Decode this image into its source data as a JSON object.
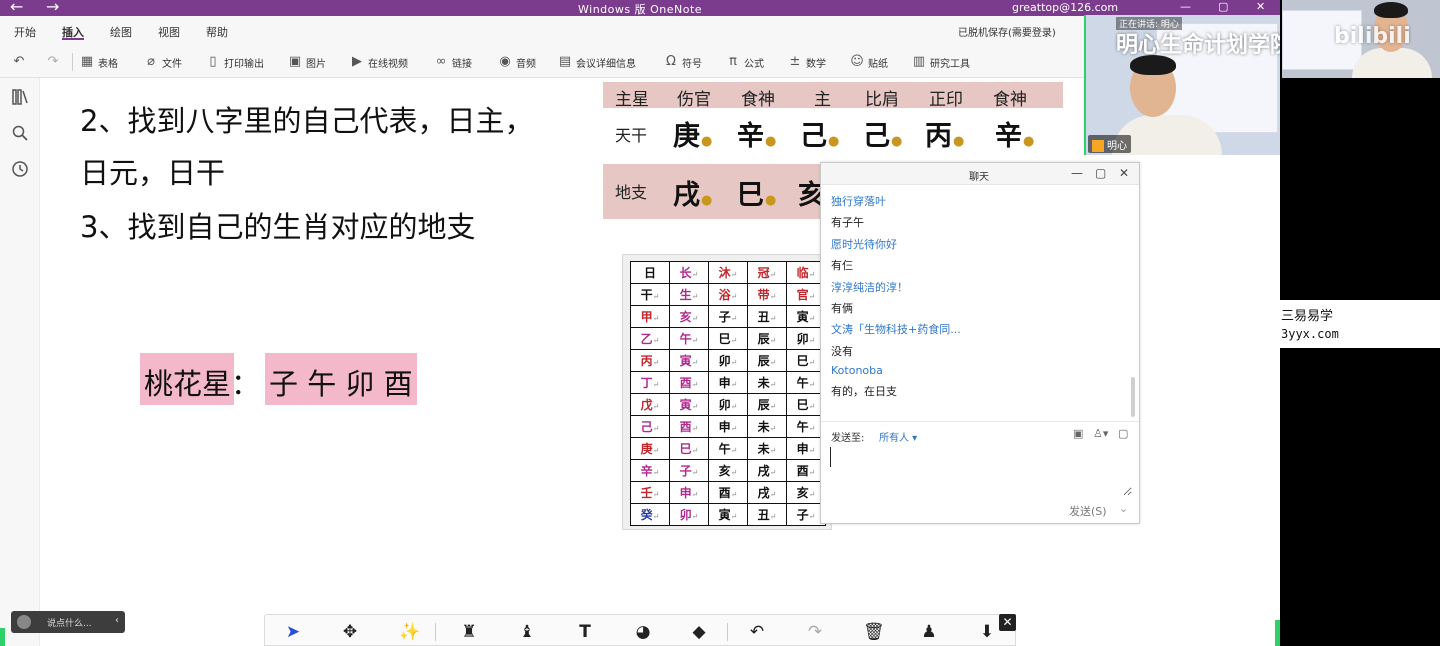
{
  "app": {
    "window_title": "Windows 版 OneNote",
    "user_email": "greattop@126.com",
    "save_status": "已脱机保存(需要登录)"
  },
  "menu_tabs": [
    "开始",
    "插入",
    "绘图",
    "视图",
    "帮助"
  ],
  "ribbon": {
    "items": [
      {
        "label": "表格",
        "icon": "table-icon"
      },
      {
        "label": "文件",
        "icon": "paperclip-icon"
      },
      {
        "label": "打印输出",
        "icon": "document-icon"
      },
      {
        "label": "图片",
        "icon": "image-icon"
      },
      {
        "label": "在线视频",
        "icon": "video-icon"
      },
      {
        "label": "链接",
        "icon": "link-icon"
      },
      {
        "label": "音频",
        "icon": "audio-icon"
      },
      {
        "label": "会议详细信息",
        "icon": "calendar-icon"
      },
      {
        "label": "符号",
        "icon": "omega-icon"
      },
      {
        "label": "公式",
        "icon": "pi-icon"
      },
      {
        "label": "数学",
        "icon": "math-icon"
      },
      {
        "label": "贴纸",
        "icon": "sticker-icon"
      },
      {
        "label": "研究工具",
        "icon": "research-icon"
      }
    ]
  },
  "note": {
    "line1": "2、找到八字里的自己代表，日主，",
    "line2": "日元，日干",
    "line3": "3、找到自己的生肖对应的地支",
    "peach_label": "桃花星：",
    "peach_list": "子 午 卯 酉"
  },
  "bazi": {
    "headers": [
      "主星",
      "伤官",
      "食神",
      "主",
      "比肩",
      "正印",
      "食神"
    ],
    "tiangan_label": "天干",
    "tiangan": [
      "庚",
      "辛",
      "己",
      "己",
      "丙",
      "辛"
    ],
    "dizhi_label": "地支",
    "dizhi": [
      "戌",
      "巳",
      "亥"
    ]
  },
  "sheng_table": {
    "rows": [
      [
        "日",
        "长",
        "沐",
        "冠",
        "临"
      ],
      [
        "干",
        "生",
        "浴",
        "带",
        "官"
      ],
      [
        "甲",
        "亥",
        "子",
        "丑",
        "寅"
      ],
      [
        "乙",
        "午",
        "巳",
        "辰",
        "卯"
      ],
      [
        "丙",
        "寅",
        "卯",
        "辰",
        "巳"
      ],
      [
        "丁",
        "酉",
        "申",
        "未",
        "午"
      ],
      [
        "戊",
        "寅",
        "卯",
        "辰",
        "巳"
      ],
      [
        "己",
        "酉",
        "申",
        "未",
        "午"
      ],
      [
        "庚",
        "巳",
        "午",
        "未",
        "申"
      ],
      [
        "辛",
        "子",
        "亥",
        "戌",
        "酉"
      ],
      [
        "壬",
        "申",
        "酉",
        "戌",
        "亥"
      ],
      [
        "癸",
        "卯",
        "寅",
        "丑",
        "子"
      ]
    ],
    "colors": {
      "red": "#c0272d",
      "purple": "#b0298f",
      "blue": "#2b3fa0",
      "black": "#111111"
    }
  },
  "chat": {
    "title": "聊天",
    "messages": [
      {
        "type": "sender",
        "text": "独行穿落叶"
      },
      {
        "type": "text",
        "text": "有子午"
      },
      {
        "type": "sender",
        "text": "愿时光待你好"
      },
      {
        "type": "text",
        "text": "有仨"
      },
      {
        "type": "sender",
        "text": "淳淳纯洁的淳！"
      },
      {
        "type": "text",
        "text": "有俩"
      },
      {
        "type": "sender",
        "text": "文涛「生物科技+药食同..."
      },
      {
        "type": "text",
        "text": "没有"
      },
      {
        "type": "sender",
        "text": "Kotonoba"
      },
      {
        "type": "text",
        "text": "有的，在日支"
      }
    ],
    "send_to_label": "发送至:",
    "send_to_value": "所有人",
    "send_button": "发送(S)"
  },
  "danmaku": {
    "placeholder": "说点什么..."
  },
  "webcam": {
    "host_name": "明心",
    "live_label": "正在讲话: 明心",
    "brand": "明心生命计划学院",
    "platform": "bilibili"
  },
  "watermark": {
    "line1": "三易易学",
    "line2": "3yyx.com"
  },
  "colors": {
    "titlebar": "#7b3c8e",
    "accent_green": "#2fd06a",
    "peach_highlight": "#f4b8cb",
    "bazi_band": "#e6c7c4",
    "chat_sender": "#2f77c9"
  }
}
